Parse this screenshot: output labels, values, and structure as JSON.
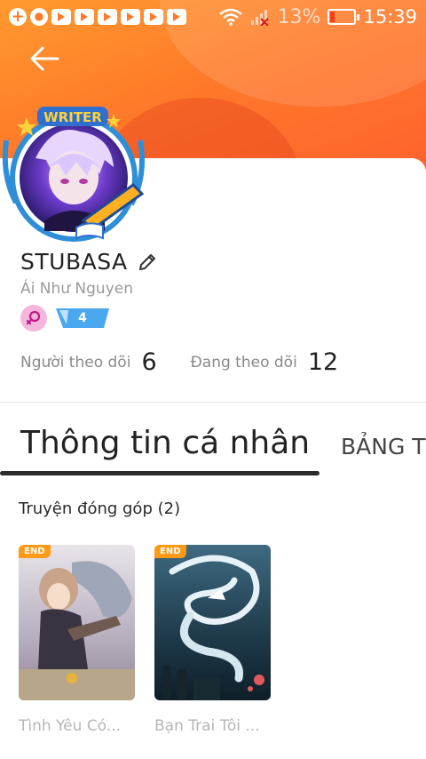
{
  "status_bar": {
    "battery_percent": "13%",
    "time": "15:39",
    "notification_icons": [
      "plus-icon",
      "chat-icon",
      "video-icon",
      "video-icon",
      "video-icon",
      "video-icon",
      "video-icon",
      "video-icon"
    ]
  },
  "profile": {
    "avatar_badge": "WRITER",
    "username": "STUBASA",
    "real_name": "Ái Như Nguyen",
    "level": "4",
    "followers_label": "Người theo dõi",
    "followers_count": "6",
    "following_label": "Đang theo dõi",
    "following_count": "12"
  },
  "tabs": {
    "active": "Thông tin cá nhân",
    "next": "BẢNG TI"
  },
  "contributions": {
    "title": "Truyện đóng góp (2)",
    "books": [
      {
        "title": "Tình Yêu Có...",
        "badge": "END"
      },
      {
        "title": "Bạn Trai Tôi ...",
        "badge": "END"
      }
    ]
  },
  "colors": {
    "header_gradient_start": "#ff9a2e",
    "header_gradient_end": "#ff5a2e",
    "badge": "#ff9a16",
    "tab_indicator": "#2b2b2b",
    "gender_badge": "#f6b6dc",
    "level_badge": "#4aa8ee"
  }
}
